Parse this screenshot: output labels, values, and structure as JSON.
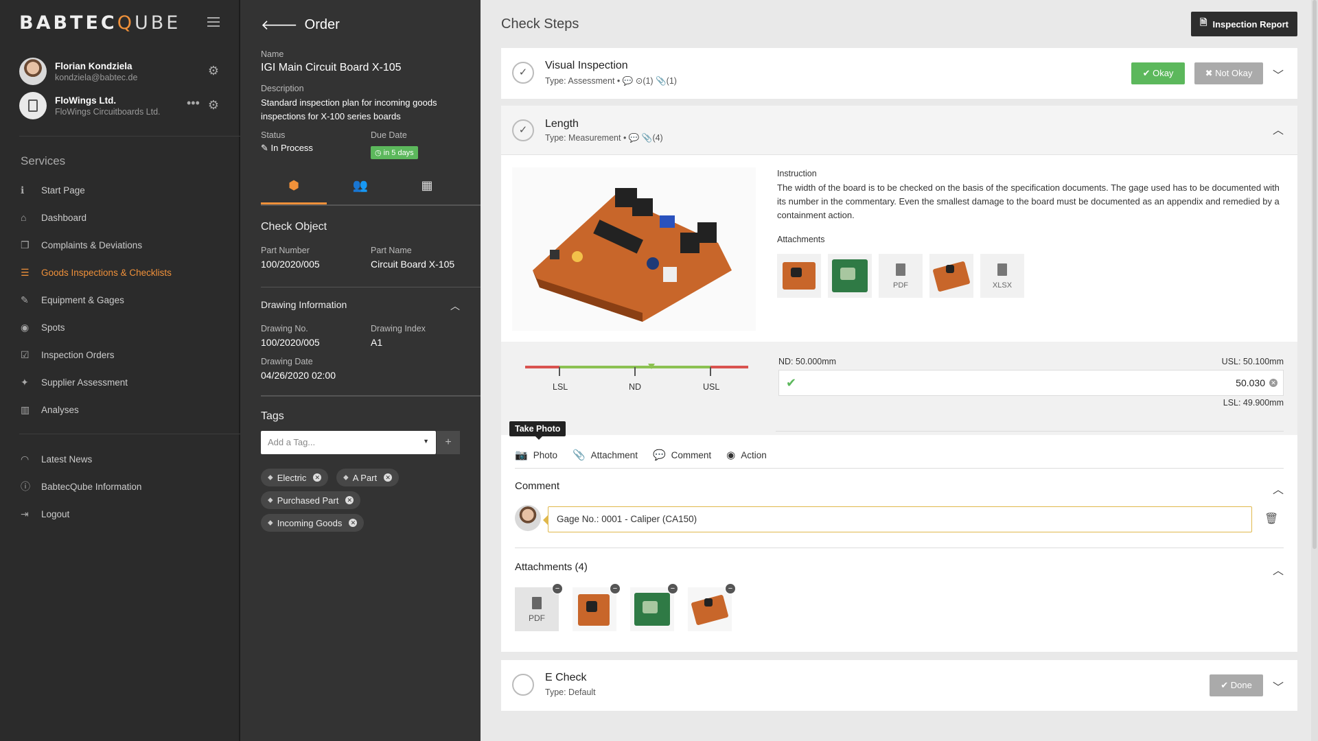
{
  "app": {
    "logo_prefix": "BABTEC",
    "logo_q": "Q",
    "logo_suffix": "UBE"
  },
  "user": {
    "name": "Florian Kondziela",
    "email": "kondziela@babtec.de"
  },
  "company": {
    "name": "FloWings Ltd.",
    "sub": "FloWings Circuitboards Ltd."
  },
  "services_title": "Services",
  "nav": [
    {
      "label": "Start Page",
      "icon": "info-icon"
    },
    {
      "label": "Dashboard",
      "icon": "home-icon"
    },
    {
      "label": "Complaints & Deviations",
      "icon": "cubes-icon"
    },
    {
      "label": "Goods Inspections & Checklists",
      "icon": "list-icon",
      "active": true
    },
    {
      "label": "Equipment & Gages",
      "icon": "wrench-icon"
    },
    {
      "label": "Spots",
      "icon": "target-icon"
    },
    {
      "label": "Inspection Orders",
      "icon": "checkbox-icon"
    },
    {
      "label": "Supplier Assessment",
      "icon": "gamepad-icon"
    },
    {
      "label": "Analyses",
      "icon": "bar-chart-icon"
    }
  ],
  "nav2": [
    {
      "label": "Latest News",
      "icon": "rss-icon"
    },
    {
      "label": "BabtecQube Information",
      "icon": "info-circle-icon"
    },
    {
      "label": "Logout",
      "icon": "logout-icon"
    }
  ],
  "order": {
    "title": "Order",
    "name_label": "Name",
    "name": "IGI Main Circuit Board X-105",
    "description_label": "Description",
    "description": "Standard inspection plan for incoming goods inspections for X-100 series boards",
    "status_label": "Status",
    "status": "In Process",
    "due_label": "Due Date",
    "due": "in 5 days",
    "check_object_title": "Check Object",
    "part_number_label": "Part Number",
    "part_number": "100/2020/005",
    "part_name_label": "Part Name",
    "part_name": "Circuit Board X-105",
    "drawing_title": "Drawing Information",
    "drawing_no_label": "Drawing No.",
    "drawing_no": "100/2020/005",
    "drawing_index_label": "Drawing Index",
    "drawing_index": "A1",
    "drawing_date_label": "Drawing Date",
    "drawing_date": "04/26/2020 02:00",
    "tags_title": "Tags",
    "tag_placeholder": "Add a Tag...",
    "tags": [
      "Electric",
      "A Part",
      "Purchased Part",
      "Incoming Goods"
    ]
  },
  "main": {
    "title": "Check Steps",
    "report_button": "Inspection Report",
    "steps": [
      {
        "name": "Visual Inspection",
        "type": "Type: Assessment",
        "comments": "(1)",
        "attachments": "(1)",
        "ok": "Okay",
        "not_ok": "Not Okay"
      },
      {
        "name": "Length",
        "type": "Type: Measurement",
        "attachments": "(4)"
      },
      {
        "name": "E Check",
        "type": "Type: Default",
        "done": "Done"
      }
    ],
    "instruction_label": "Instruction",
    "instruction": "The width of the board is to be checked on the basis of the specification documents. The gage used has to be documented with its number in the commentary. Even the smallest damage to the board must be documented as an appendix and remedied by a containment action.",
    "attachments_label": "Attachments",
    "attachment_exts": [
      "PDF",
      "XLSX"
    ],
    "scale": {
      "lsl": "LSL",
      "nd": "ND",
      "usl": "USL"
    },
    "nd_text": "ND: 50.000mm",
    "usl_text": "USL: 50.100mm",
    "lsl_text": "LSL: 49.900mm",
    "measured_value": "50.030",
    "tooltip": "Take Photo",
    "actions": [
      "Photo",
      "Attachment",
      "Comment",
      "Action"
    ],
    "comment_title": "Comment",
    "comment_text": "Gage No.: 0001 - Caliper (CA150)",
    "attachments_title": "Attachments (4)",
    "attachment_pdf": "PDF"
  },
  "colors": {
    "accent": "#f0913a",
    "ok": "#5cb85c",
    "sidebar": "#2b2b2b",
    "panel": "#333333"
  }
}
